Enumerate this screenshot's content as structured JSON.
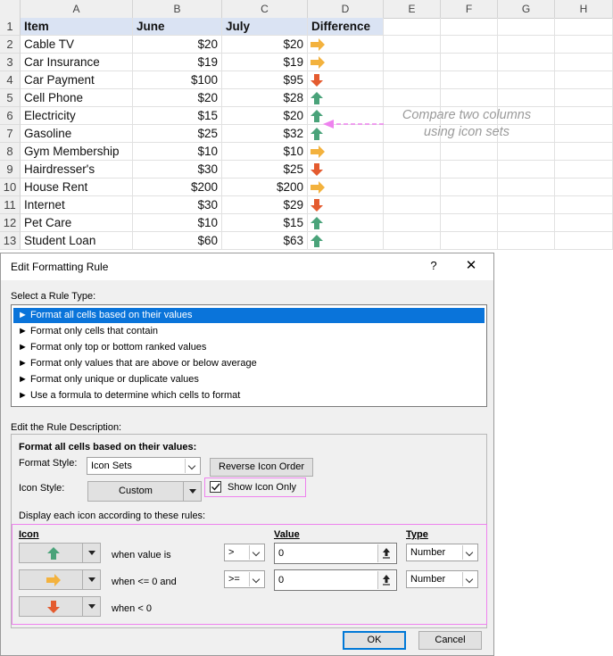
{
  "sheet": {
    "column_headers": [
      "A",
      "B",
      "C",
      "D",
      "E",
      "F",
      "G",
      "H"
    ],
    "header_row": {
      "row_number": "1",
      "item": "Item",
      "june": "June",
      "july": "July",
      "difference": "Difference"
    },
    "rows": [
      {
        "row_number": "2",
        "item": "Cable TV",
        "june": "$20",
        "july": "$20",
        "icon": "arrow-right-yellow-icon"
      },
      {
        "row_number": "3",
        "item": "Car Insurance",
        "june": "$19",
        "july": "$19",
        "icon": "arrow-right-yellow-icon"
      },
      {
        "row_number": "4",
        "item": "Car Payment",
        "june": "$100",
        "july": "$95",
        "icon": "arrow-down-red-icon"
      },
      {
        "row_number": "5",
        "item": "Cell Phone",
        "june": "$20",
        "july": "$28",
        "icon": "arrow-up-green-icon"
      },
      {
        "row_number": "6",
        "item": "Electricity",
        "june": "$15",
        "july": "$20",
        "icon": "arrow-up-green-icon"
      },
      {
        "row_number": "7",
        "item": "Gasoline",
        "june": "$25",
        "july": "$32",
        "icon": "arrow-up-green-icon"
      },
      {
        "row_number": "8",
        "item": "Gym Membership",
        "june": "$10",
        "july": "$10",
        "icon": "arrow-right-yellow-icon"
      },
      {
        "row_number": "9",
        "item": "Hairdresser's",
        "june": "$30",
        "july": "$25",
        "icon": "arrow-down-red-icon"
      },
      {
        "row_number": "10",
        "item": "House Rent",
        "june": "$200",
        "july": "$200",
        "icon": "arrow-right-yellow-icon"
      },
      {
        "row_number": "11",
        "item": "Internet",
        "june": "$30",
        "july": "$29",
        "icon": "arrow-down-red-icon"
      },
      {
        "row_number": "12",
        "item": "Pet Care",
        "june": "$10",
        "july": "$15",
        "icon": "arrow-up-green-icon"
      },
      {
        "row_number": "13",
        "item": "Student Loan",
        "june": "$60",
        "july": "$63",
        "icon": "arrow-up-green-icon"
      }
    ],
    "annotation": {
      "line1": "Compare two columns",
      "line2": "using icon sets"
    }
  },
  "dialog": {
    "title": "Edit Formatting Rule",
    "help_label": "?",
    "close_label": "✕",
    "rule_type_label": "Select a Rule Type:",
    "rule_types": [
      "► Format all cells based on their values",
      "► Format only cells that contain",
      "► Format only top or bottom ranked values",
      "► Format only values that are above or below average",
      "► Format only unique or duplicate values",
      "► Use a formula to determine which cells to format"
    ],
    "selected_rule_index": 0,
    "rule_desc_label": "Edit the Rule Description:",
    "desc_heading": "Format all cells based on their values:",
    "format_style_label": "Format Style:",
    "format_style_value": "Icon Sets",
    "reverse_button": "Reverse Icon Order",
    "icon_style_label": "Icon Style:",
    "icon_style_value": "Custom",
    "show_icon_only_label": "Show Icon Only",
    "show_icon_only_checked": true,
    "display_rules_label": "Display each icon according to these rules:",
    "col_icon": "Icon",
    "col_value": "Value",
    "col_type": "Type",
    "icon_rules": [
      {
        "icon": "arrow-up-green-icon",
        "condition": "when value is",
        "operator": ">",
        "value": "0",
        "type": "Number"
      },
      {
        "icon": "arrow-right-yellow-icon",
        "condition": "when <= 0 and",
        "operator": ">=",
        "value": "0",
        "type": "Number"
      },
      {
        "icon": "arrow-down-red-icon",
        "condition": "when < 0"
      }
    ],
    "ok_label": "OK",
    "cancel_label": "Cancel"
  },
  "colors": {
    "header_fill": "#dae3f3",
    "arrow_up": "#4aa37a",
    "arrow_right": "#f3b23e",
    "arrow_down": "#e45b2f",
    "highlight": "#ee82ee",
    "selection": "#0a74da"
  }
}
